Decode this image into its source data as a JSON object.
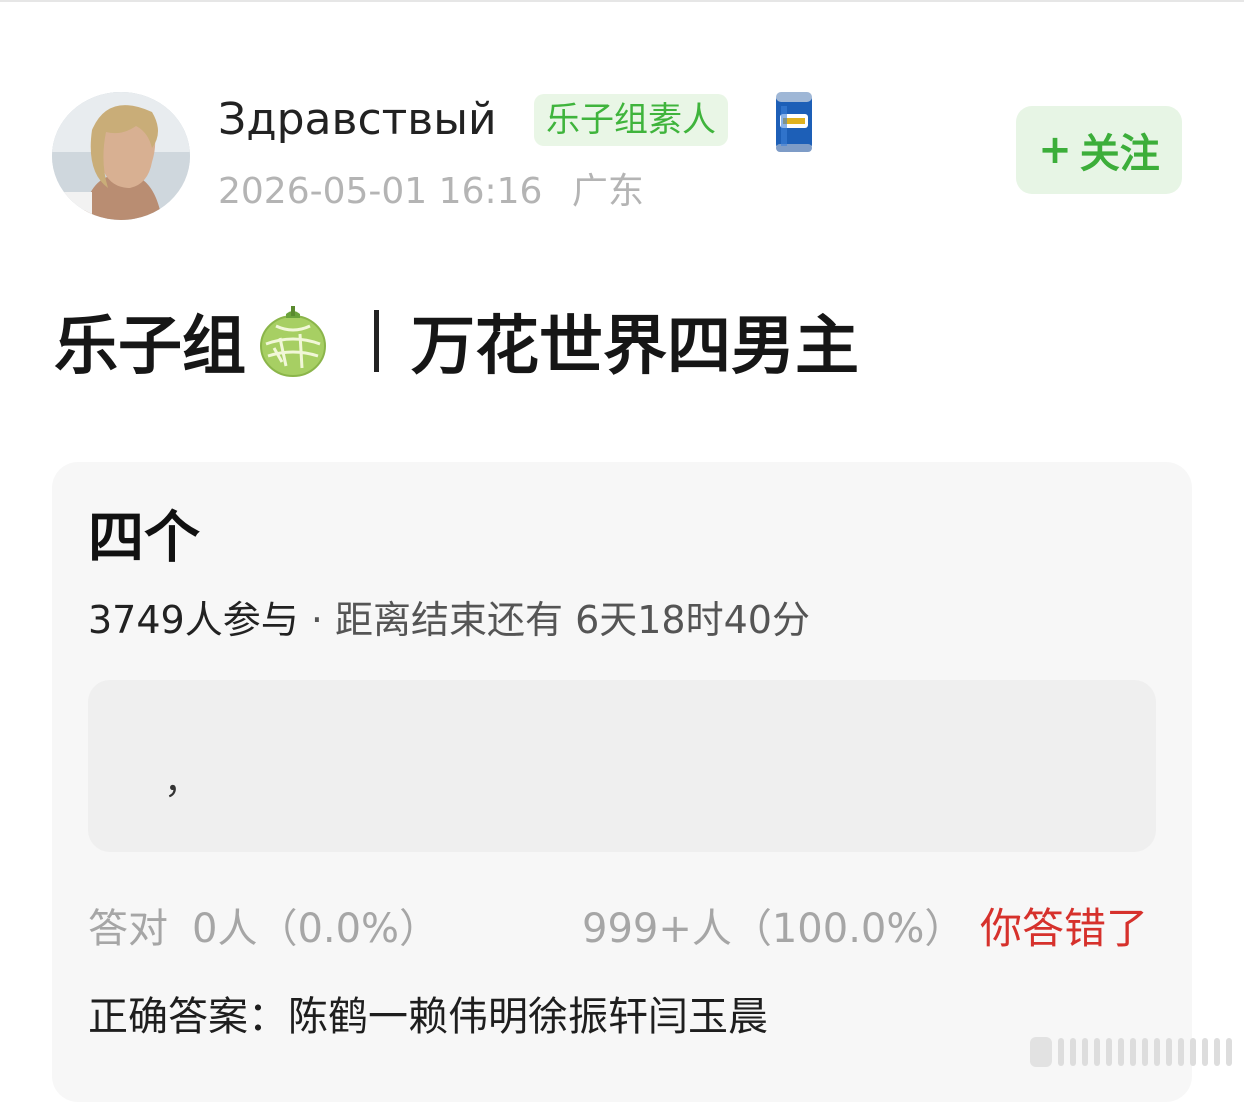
{
  "post": {
    "author": {
      "name": "Здравствый",
      "badge": "乐子组素人",
      "avatar_icon": "avatar-photo",
      "decoration_icon": "beer-can-icon"
    },
    "meta": {
      "time": "2026-05-01 16:16",
      "location": "广东"
    },
    "follow_label": "关注",
    "title": {
      "group": "乐子组",
      "group_icon": "melon-icon",
      "topic": "万花世界四男主"
    }
  },
  "quiz": {
    "question": "四个",
    "participants": "3749人参与",
    "separator": "·",
    "remaining": "距离结束还有 6天18时40分",
    "answer_input": "，",
    "correct_stat_label": "答对",
    "correct_stat_value": "0人（0.0%）",
    "wrong_stat_value": "999+人（100.0%）",
    "result_label": "你答错了",
    "correct_answer_label": "正确答案：",
    "correct_answer": "陈鹤一赖伟明徐振轩闫玉晨",
    "colors": {
      "wrong": "#d6312c",
      "accent": "#3cae3a"
    }
  }
}
